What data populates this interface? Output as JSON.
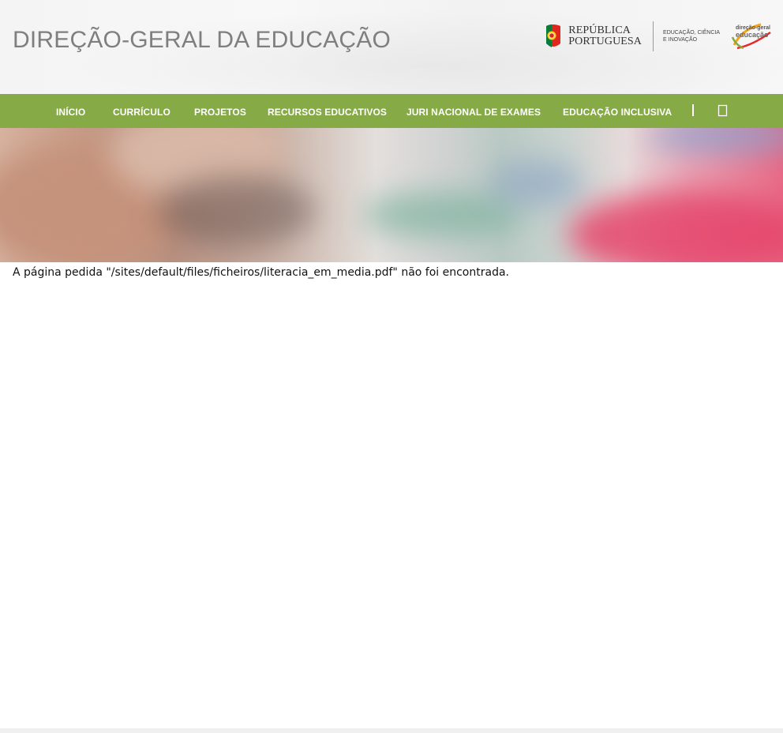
{
  "header": {
    "site_title": "DIREÇÃO-GERAL DA EDUCAÇÃO",
    "republica": {
      "line1": "REPÚBLICA",
      "line2": "PORTUGUESA"
    },
    "ministry": {
      "line1": "EDUCAÇÃO, CIÊNCIA",
      "line2": "E INOVAÇÃO"
    },
    "dge_logo": {
      "line1": "direção-geral",
      "line2": "educação"
    }
  },
  "nav": {
    "items": [
      {
        "label": "INÍCIO"
      },
      {
        "label": "CURRÍCULO"
      },
      {
        "label": "PROJETOS"
      },
      {
        "label": "RECURSOS EDUCATIVOS"
      },
      {
        "label": "JURI NACIONAL DE EXAMES"
      },
      {
        "label": "EDUCAÇÃO INCLUSIVA"
      }
    ],
    "separator": "|",
    "search_icon": "search-icon"
  },
  "main": {
    "not_found_message": "A página pedida \"/sites/default/files/ficheiros/literacia_em_media.pdf\" não foi encontrada."
  },
  "colors": {
    "nav_background": "#86aa45",
    "title_gray": "#7f7f82"
  }
}
